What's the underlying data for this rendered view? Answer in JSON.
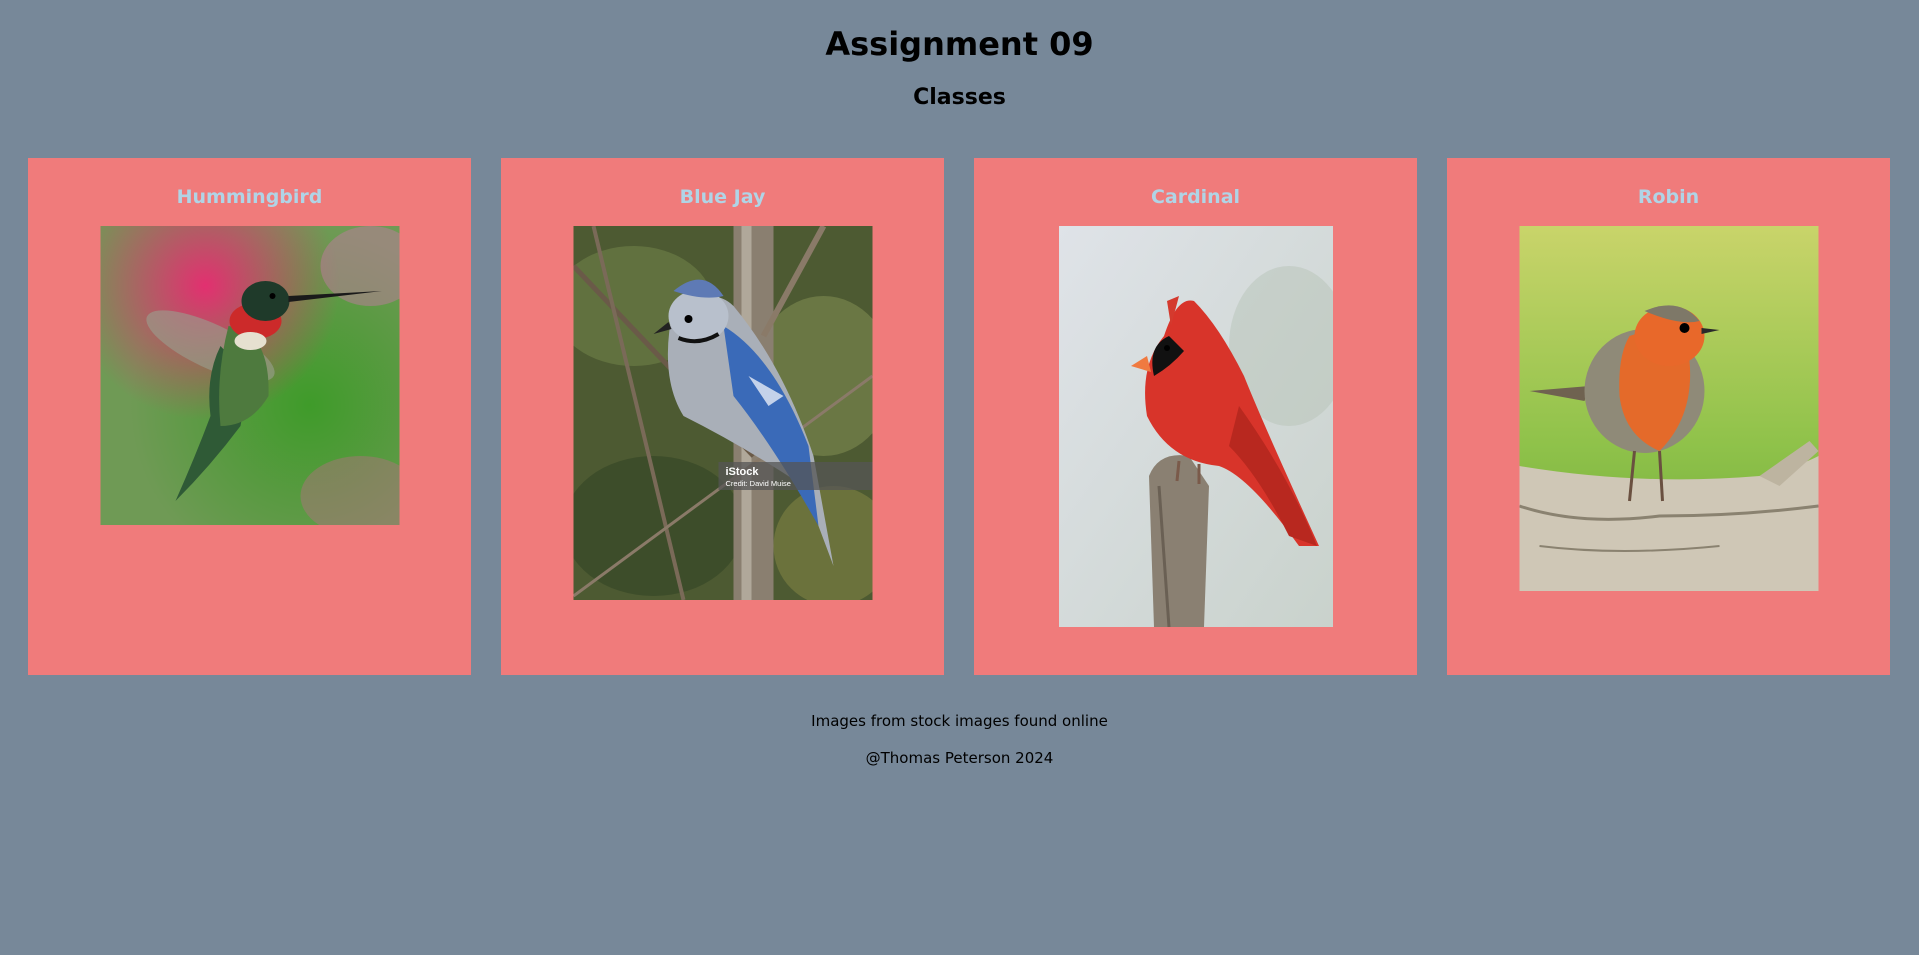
{
  "header": {
    "title": "Assignment 09",
    "subtitle": "Classes"
  },
  "cards": [
    {
      "title": "Hummingbird"
    },
    {
      "title": "Blue Jay",
      "watermark": {
        "brand": "iStock",
        "credit": "Credit: David Muise"
      }
    },
    {
      "title": "Cardinal"
    },
    {
      "title": "Robin"
    }
  ],
  "footer": {
    "credit": "Images from stock images found online",
    "copyright": "@Thomas Peterson 2024"
  },
  "colors": {
    "background": "#778899",
    "card": "#f07b7b",
    "card_title": "#b0d4e6"
  }
}
